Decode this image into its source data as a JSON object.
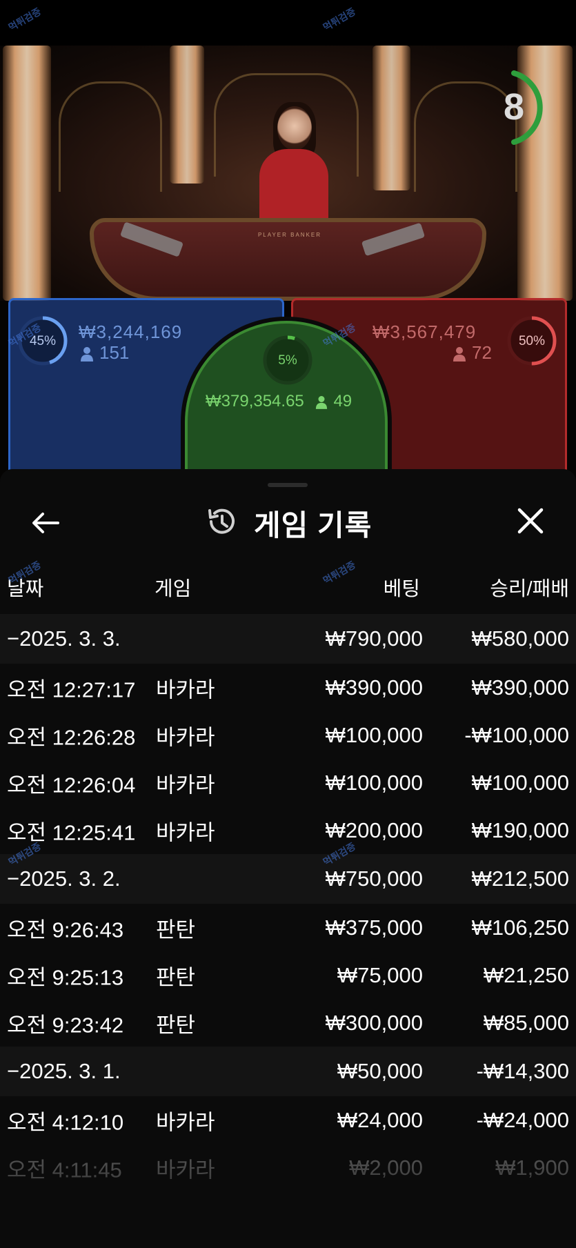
{
  "game_view": {
    "countdown": "8",
    "table_text": "PLAYER     BANKER",
    "player": {
      "percent_label": "45%",
      "percent": 45,
      "amount": "₩3,244,169",
      "players": "151",
      "color": "#2d66c9"
    },
    "banker": {
      "percent_label": "50%",
      "percent": 50,
      "amount": "₩3,567,479",
      "players": "72",
      "color": "#b32b2b"
    },
    "tie": {
      "percent_label": "5%",
      "percent": 5,
      "amount": "₩379,354.65",
      "players": "49",
      "color": "#3b8a32"
    }
  },
  "watermark": "먹튀검증",
  "history": {
    "title": "게임 기록",
    "columns": {
      "date": "날짜",
      "game": "게임",
      "bet": "베팅",
      "win_loss": "승리/패배"
    },
    "rows": [
      {
        "type": "group",
        "date": "−2025. 3. 3.",
        "game": "",
        "bet": "₩790,000",
        "win_loss": "₩580,000"
      },
      {
        "type": "item",
        "date": "오전 12:27:17",
        "game": "바카라",
        "bet": "₩390,000",
        "win_loss": "₩390,000"
      },
      {
        "type": "item",
        "date": "오전 12:26:28",
        "game": "바카라",
        "bet": "₩100,000",
        "win_loss": "-₩100,000"
      },
      {
        "type": "item",
        "date": "오전 12:26:04",
        "game": "바카라",
        "bet": "₩100,000",
        "win_loss": "₩100,000"
      },
      {
        "type": "item",
        "date": "오전 12:25:41",
        "game": "바카라",
        "bet": "₩200,000",
        "win_loss": "₩190,000"
      },
      {
        "type": "group",
        "date": "−2025. 3. 2.",
        "game": "",
        "bet": "₩750,000",
        "win_loss": "₩212,500"
      },
      {
        "type": "item",
        "date": "오전 9:26:43",
        "game": "판탄",
        "bet": "₩375,000",
        "win_loss": "₩106,250"
      },
      {
        "type": "item",
        "date": "오전 9:25:13",
        "game": "판탄",
        "bet": "₩75,000",
        "win_loss": "₩21,250"
      },
      {
        "type": "item",
        "date": "오전 9:23:42",
        "game": "판탄",
        "bet": "₩300,000",
        "win_loss": "₩85,000"
      },
      {
        "type": "group",
        "date": "−2025. 3. 1.",
        "game": "",
        "bet": "₩50,000",
        "win_loss": "-₩14,300"
      },
      {
        "type": "item",
        "date": "오전 4:12:10",
        "game": "바카라",
        "bet": "₩24,000",
        "win_loss": "-₩24,000"
      },
      {
        "type": "item",
        "date": "오전 4:11:45",
        "game": "바카라",
        "bet": "₩2,000",
        "win_loss": "₩1,900"
      }
    ]
  }
}
